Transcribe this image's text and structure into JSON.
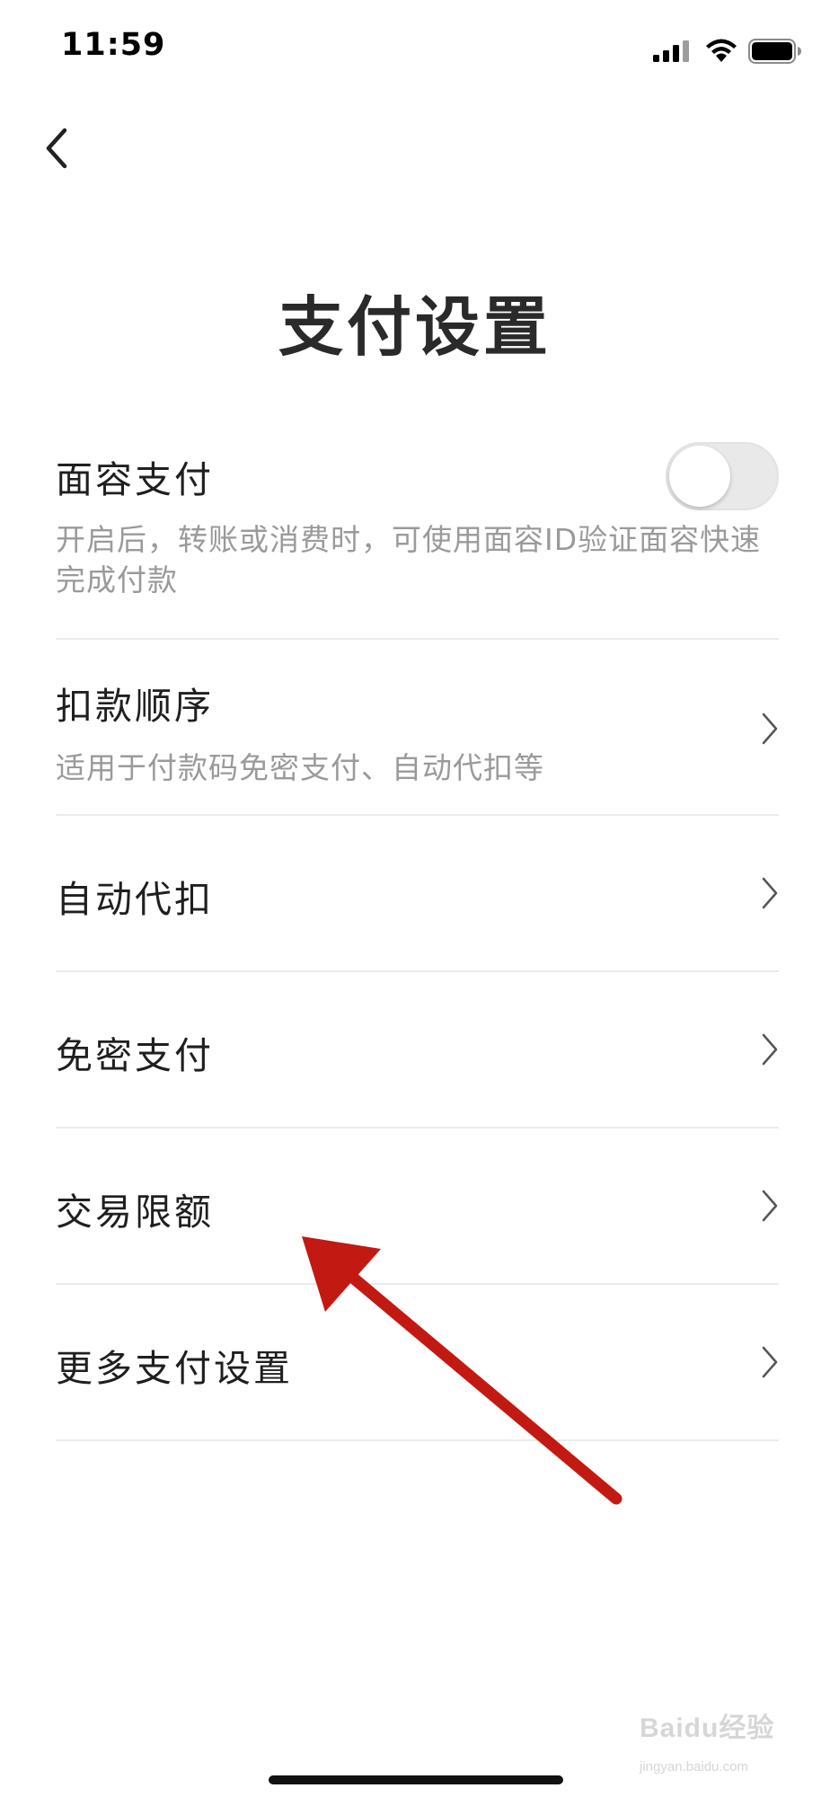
{
  "status_bar": {
    "time": "11:59",
    "signal_icon": "cellular-signal-icon",
    "wifi_icon": "wifi-icon",
    "battery_icon": "battery-icon"
  },
  "nav": {
    "back_icon": "chevron-left-icon"
  },
  "page": {
    "title": "支付设置"
  },
  "settings": [
    {
      "title": "面容支付",
      "description": "开启后，转账或消费时，可使用面容ID验证面容快速完成付款",
      "control": "toggle",
      "toggle_on": false
    },
    {
      "title": "扣款顺序",
      "description": "适用于付款码免密支付、自动代扣等",
      "control": "chevron"
    },
    {
      "title": "自动代扣",
      "control": "chevron"
    },
    {
      "title": "免密支付",
      "control": "chevron"
    },
    {
      "title": "交易限额",
      "control": "chevron"
    },
    {
      "title": "更多支付设置",
      "control": "chevron"
    }
  ],
  "annotation": {
    "arrow_color": "#c21a12",
    "points_to": "交易限额"
  },
  "watermark": {
    "text": "Baidu经验",
    "sub": "jingyan.baidu.com"
  },
  "colors": {
    "background": "#ffffff",
    "text": "#1f1f1f",
    "secondary_text": "#9a9a9a",
    "divider": "#ebebeb"
  }
}
